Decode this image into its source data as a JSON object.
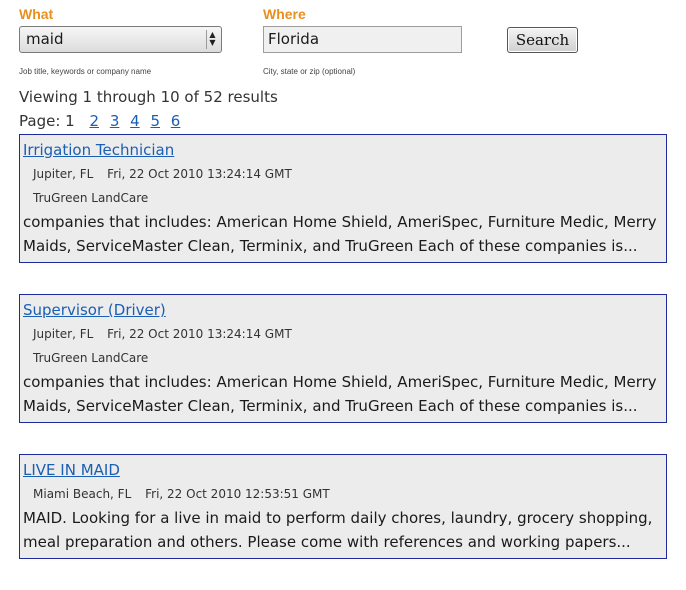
{
  "search": {
    "what_label": "What",
    "what_value": "maid",
    "what_hint": "Job title, keywords or company name",
    "where_label": "Where",
    "where_value": "Florida",
    "where_hint": "City, state or zip (optional)",
    "button_label": "Search"
  },
  "summary": "Viewing 1 through 10 of 52 results",
  "pager": {
    "label": "Page:",
    "current": "1",
    "links": [
      "2",
      "3",
      "4",
      "5",
      "6"
    ]
  },
  "results": [
    {
      "title": "Irrigation Technician",
      "location": "Jupiter, FL",
      "date": "Fri, 22 Oct 2010 13:24:14 GMT",
      "company": "TruGreen LandCare",
      "snippet": "companies that includes: American Home Shield, AmeriSpec, Furniture Medic, Merry Maids, ServiceMaster Clean, Terminix, and TruGreen Each of these companies is..."
    },
    {
      "title": "Supervisor (Driver)",
      "location": "Jupiter, FL",
      "date": "Fri, 22 Oct 2010 13:24:14 GMT",
      "company": "TruGreen LandCare",
      "snippet": "companies that includes: American Home Shield, AmeriSpec, Furniture Medic, Merry Maids, ServiceMaster Clean, Terminix, and TruGreen Each of these companies is..."
    },
    {
      "title": "LIVE IN MAID",
      "location": "Miami Beach, FL",
      "date": "Fri, 22 Oct 2010 12:53:51 GMT",
      "company": "",
      "snippet": "MAID. Looking for a live in maid to perform daily chores, laundry, grocery shopping, meal preparation and others. Please come with references and working papers..."
    }
  ]
}
